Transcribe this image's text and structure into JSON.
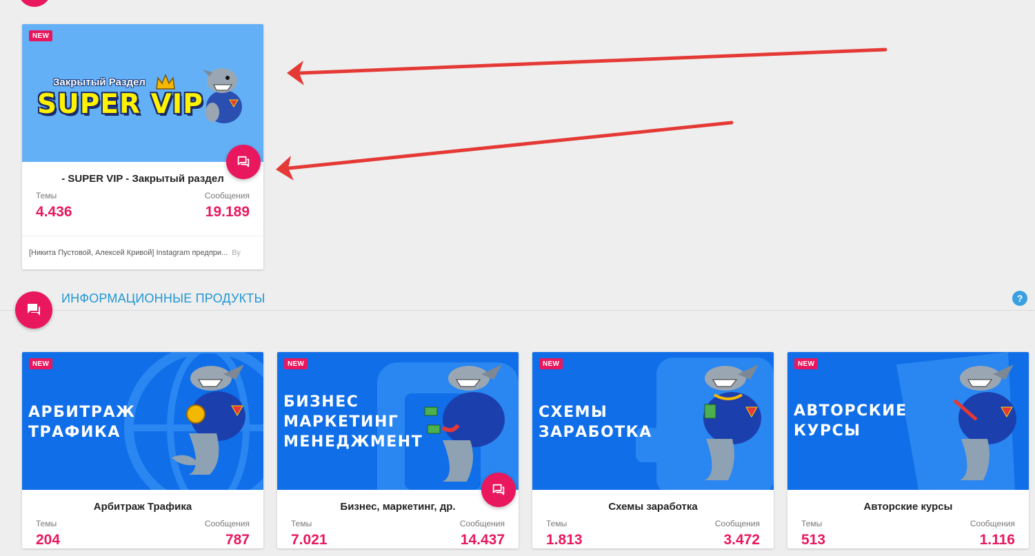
{
  "colors": {
    "accent": "#e9175d",
    "section_title": "#2196d3",
    "vip_banner": "#64b0f6",
    "product_banner": "#0f6ee8"
  },
  "vip_card": {
    "badge": "NEW",
    "banner_top_text": "Закрытый Раздел",
    "banner_main_text": "SUPER VIP",
    "title": "- SUPER VIP - Закрытый раздел",
    "topics_label": "Темы",
    "topics_value": "4.436",
    "messages_label": "Сообщения",
    "messages_value": "19.189",
    "last_post": "[Никита Пустовой, Алексей Кривой] Instagram предпри...",
    "last_post_by": "Ву"
  },
  "section": {
    "title": "ИНФОРМАЦИОННЫЕ ПРОДУКТЫ",
    "help_icon": "help-icon"
  },
  "cards": [
    {
      "badge": "NEW",
      "banner_lines": [
        "АРБИТРАЖ",
        "ТРАФИКА"
      ],
      "title": "Арбитраж Трафика",
      "topics_label": "Темы",
      "topics_value": "204",
      "messages_label": "Сообщения",
      "messages_value": "787"
    },
    {
      "badge": "NEW",
      "banner_lines": [
        "БИЗНЕС",
        "МАРКЕТИНГ",
        "МЕНЕДЖМЕНТ"
      ],
      "title": "Бизнес, маркетинг, др.",
      "topics_label": "Темы",
      "topics_value": "7.021",
      "messages_label": "Сообщения",
      "messages_value": "14.437"
    },
    {
      "badge": "NEW",
      "banner_lines": [
        "СХЕМЫ",
        "ЗАРАБОТКА"
      ],
      "title": "Схемы заработка",
      "topics_label": "Темы",
      "topics_value": "1.813",
      "messages_label": "Сообщения",
      "messages_value": "3.472"
    },
    {
      "badge": "NEW",
      "banner_lines": [
        "АВТОРСКИЕ",
        "КУРСЫ"
      ],
      "title": "Авторские курсы",
      "topics_label": "Темы",
      "topics_value": "513",
      "messages_label": "Сообщения",
      "messages_value": "1.116"
    }
  ]
}
